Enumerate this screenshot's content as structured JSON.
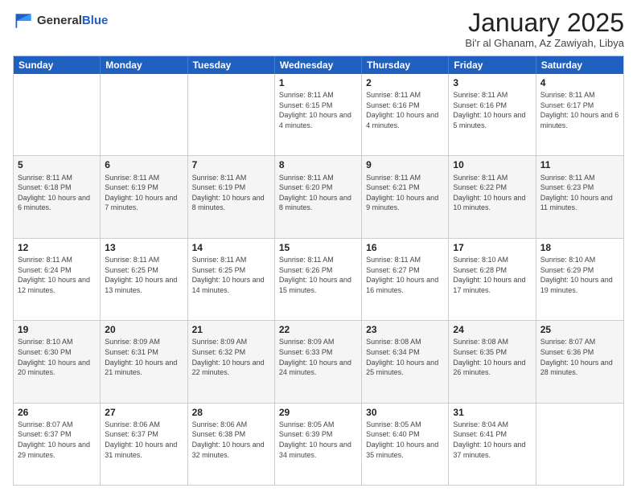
{
  "header": {
    "logo_general": "General",
    "logo_blue": "Blue",
    "month_title": "January 2025",
    "location": "Bi'r al Ghanam, Az Zawiyah, Libya"
  },
  "days_of_week": [
    "Sunday",
    "Monday",
    "Tuesday",
    "Wednesday",
    "Thursday",
    "Friday",
    "Saturday"
  ],
  "weeks": [
    [
      {
        "day": "",
        "info": ""
      },
      {
        "day": "",
        "info": ""
      },
      {
        "day": "",
        "info": ""
      },
      {
        "day": "1",
        "info": "Sunrise: 8:11 AM\nSunset: 6:15 PM\nDaylight: 10 hours\nand 4 minutes."
      },
      {
        "day": "2",
        "info": "Sunrise: 8:11 AM\nSunset: 6:16 PM\nDaylight: 10 hours\nand 4 minutes."
      },
      {
        "day": "3",
        "info": "Sunrise: 8:11 AM\nSunset: 6:16 PM\nDaylight: 10 hours\nand 5 minutes."
      },
      {
        "day": "4",
        "info": "Sunrise: 8:11 AM\nSunset: 6:17 PM\nDaylight: 10 hours\nand 6 minutes."
      }
    ],
    [
      {
        "day": "5",
        "info": "Sunrise: 8:11 AM\nSunset: 6:18 PM\nDaylight: 10 hours\nand 6 minutes."
      },
      {
        "day": "6",
        "info": "Sunrise: 8:11 AM\nSunset: 6:19 PM\nDaylight: 10 hours\nand 7 minutes."
      },
      {
        "day": "7",
        "info": "Sunrise: 8:11 AM\nSunset: 6:19 PM\nDaylight: 10 hours\nand 8 minutes."
      },
      {
        "day": "8",
        "info": "Sunrise: 8:11 AM\nSunset: 6:20 PM\nDaylight: 10 hours\nand 8 minutes."
      },
      {
        "day": "9",
        "info": "Sunrise: 8:11 AM\nSunset: 6:21 PM\nDaylight: 10 hours\nand 9 minutes."
      },
      {
        "day": "10",
        "info": "Sunrise: 8:11 AM\nSunset: 6:22 PM\nDaylight: 10 hours\nand 10 minutes."
      },
      {
        "day": "11",
        "info": "Sunrise: 8:11 AM\nSunset: 6:23 PM\nDaylight: 10 hours\nand 11 minutes."
      }
    ],
    [
      {
        "day": "12",
        "info": "Sunrise: 8:11 AM\nSunset: 6:24 PM\nDaylight: 10 hours\nand 12 minutes."
      },
      {
        "day": "13",
        "info": "Sunrise: 8:11 AM\nSunset: 6:25 PM\nDaylight: 10 hours\nand 13 minutes."
      },
      {
        "day": "14",
        "info": "Sunrise: 8:11 AM\nSunset: 6:25 PM\nDaylight: 10 hours\nand 14 minutes."
      },
      {
        "day": "15",
        "info": "Sunrise: 8:11 AM\nSunset: 6:26 PM\nDaylight: 10 hours\nand 15 minutes."
      },
      {
        "day": "16",
        "info": "Sunrise: 8:11 AM\nSunset: 6:27 PM\nDaylight: 10 hours\nand 16 minutes."
      },
      {
        "day": "17",
        "info": "Sunrise: 8:10 AM\nSunset: 6:28 PM\nDaylight: 10 hours\nand 17 minutes."
      },
      {
        "day": "18",
        "info": "Sunrise: 8:10 AM\nSunset: 6:29 PM\nDaylight: 10 hours\nand 19 minutes."
      }
    ],
    [
      {
        "day": "19",
        "info": "Sunrise: 8:10 AM\nSunset: 6:30 PM\nDaylight: 10 hours\nand 20 minutes."
      },
      {
        "day": "20",
        "info": "Sunrise: 8:09 AM\nSunset: 6:31 PM\nDaylight: 10 hours\nand 21 minutes."
      },
      {
        "day": "21",
        "info": "Sunrise: 8:09 AM\nSunset: 6:32 PM\nDaylight: 10 hours\nand 22 minutes."
      },
      {
        "day": "22",
        "info": "Sunrise: 8:09 AM\nSunset: 6:33 PM\nDaylight: 10 hours\nand 24 minutes."
      },
      {
        "day": "23",
        "info": "Sunrise: 8:08 AM\nSunset: 6:34 PM\nDaylight: 10 hours\nand 25 minutes."
      },
      {
        "day": "24",
        "info": "Sunrise: 8:08 AM\nSunset: 6:35 PM\nDaylight: 10 hours\nand 26 minutes."
      },
      {
        "day": "25",
        "info": "Sunrise: 8:07 AM\nSunset: 6:36 PM\nDaylight: 10 hours\nand 28 minutes."
      }
    ],
    [
      {
        "day": "26",
        "info": "Sunrise: 8:07 AM\nSunset: 6:37 PM\nDaylight: 10 hours\nand 29 minutes."
      },
      {
        "day": "27",
        "info": "Sunrise: 8:06 AM\nSunset: 6:37 PM\nDaylight: 10 hours\nand 31 minutes."
      },
      {
        "day": "28",
        "info": "Sunrise: 8:06 AM\nSunset: 6:38 PM\nDaylight: 10 hours\nand 32 minutes."
      },
      {
        "day": "29",
        "info": "Sunrise: 8:05 AM\nSunset: 6:39 PM\nDaylight: 10 hours\nand 34 minutes."
      },
      {
        "day": "30",
        "info": "Sunrise: 8:05 AM\nSunset: 6:40 PM\nDaylight: 10 hours\nand 35 minutes."
      },
      {
        "day": "31",
        "info": "Sunrise: 8:04 AM\nSunset: 6:41 PM\nDaylight: 10 hours\nand 37 minutes."
      },
      {
        "day": "",
        "info": ""
      }
    ]
  ]
}
